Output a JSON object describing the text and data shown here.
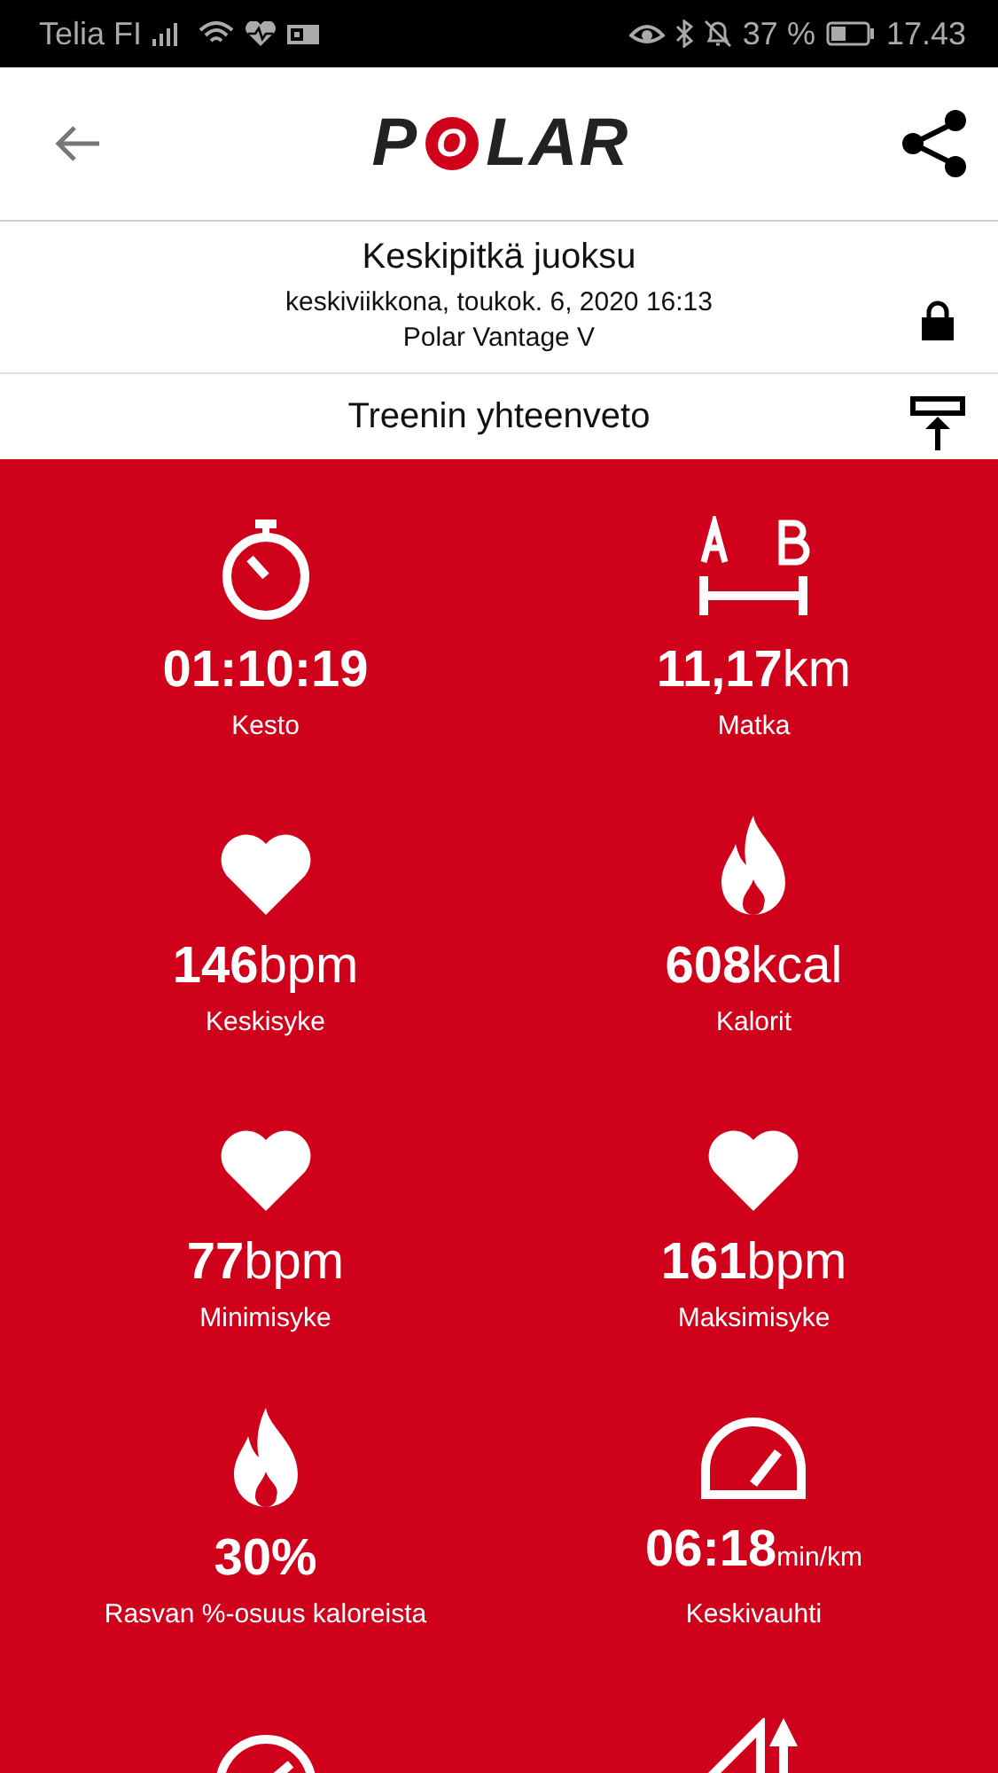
{
  "status_bar": {
    "carrier": "Telia FI",
    "battery_text": "37 %",
    "time": "17.43"
  },
  "header": {
    "logo": "POLAR"
  },
  "session": {
    "title": "Keskipitkä juoksu",
    "date": "keskiviikkona, toukok. 6, 2020 16:13",
    "device": "Polar Vantage V"
  },
  "section": {
    "title": "Treenin yhteenveto"
  },
  "stats": [
    {
      "kind": "duration",
      "value": "01:10:19",
      "label": "Kesto"
    },
    {
      "kind": "distance",
      "value": "11,17",
      "unit": "km",
      "label": "Matka"
    },
    {
      "kind": "heart",
      "value": "146",
      "unit": "bpm",
      "label": "Keskisyke"
    },
    {
      "kind": "calories",
      "value": "608",
      "unit": "kcal",
      "label": "Kalorit"
    },
    {
      "kind": "heart",
      "value": "77",
      "unit": "bpm",
      "label": "Minimisyke"
    },
    {
      "kind": "heart",
      "value": "161",
      "unit": "bpm",
      "label": "Maksimisyke"
    },
    {
      "kind": "calories",
      "value": "30%",
      "label": "Rasvan %-osuus kaloreista"
    },
    {
      "kind": "pace",
      "value": "06:18",
      "unit": "min/km",
      "label": "Keskivauhti"
    },
    {
      "kind": "speed"
    },
    {
      "kind": "ascent"
    }
  ]
}
